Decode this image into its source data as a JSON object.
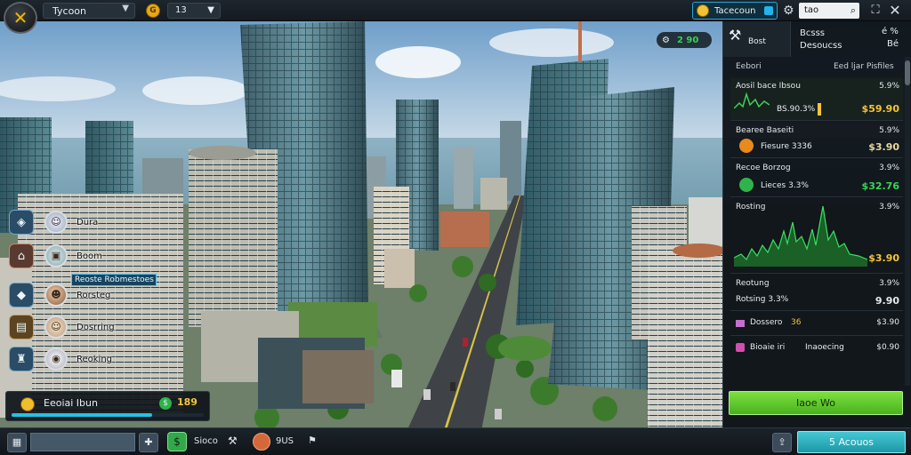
{
  "topbar": {
    "app_title": "Tycoon",
    "level_value": "13",
    "money_value": "Tacecoun",
    "search_value": "tao"
  },
  "hud": {
    "badge_value": "2 90"
  },
  "left_menu": {
    "items": [
      {
        "label": "Dura",
        "icon": "coin-stack-icon"
      },
      {
        "label": "Boom",
        "icon": "house-icon"
      },
      {
        "label": "Rorsteg",
        "icon": "person-avatar-icon"
      },
      {
        "label": "Dosrring",
        "icon": "chart-icon"
      },
      {
        "label": "Reoking",
        "icon": "crest-icon"
      }
    ],
    "callout": "Reoste Robmestoes"
  },
  "bottom_left": {
    "label": "Eeoiai Ibun",
    "value": "189",
    "progress": 0.73
  },
  "bottombar": {
    "text1": "Sioco",
    "text2": "9US",
    "action_label": "5 Acouos"
  },
  "right_panel": {
    "header_icon_label": "Bost",
    "col1_line1": "Bcsss",
    "col1_line1_right": "é %",
    "col1_line2": "Desoucss",
    "col1_line2_right": "Bé",
    "sub_left": "Eebori",
    "sub_right": "Eed ljar Pisfiles",
    "rows": [
      {
        "name": "Aosil bace Ibsou",
        "right": "5.9%",
        "sub": "BS.90.3%",
        "amount": "$59.90"
      },
      {
        "name": "Bearee Baseiti",
        "right": "5.9%",
        "sub": "Fiesure 3336",
        "amount": "$3.90"
      },
      {
        "name": "Recoe Borzog",
        "right": "3.9%",
        "sub": "Lieces 3.3%",
        "amount": "$32.76"
      },
      {
        "name": "Rosting",
        "right": "3.9%",
        "amount": "$3.90"
      },
      {
        "name": "Reotung",
        "right": "3.9%",
        "sub": "Rotsing 3.3%",
        "amount": "9.90"
      },
      {
        "name": "Dossero",
        "sub": "36",
        "amount": "$3.90"
      },
      {
        "name": "Bioaie iri",
        "sub": "Inaoecing",
        "amount": "$0.90"
      }
    ],
    "button_label": "Iaoe Wo"
  }
}
